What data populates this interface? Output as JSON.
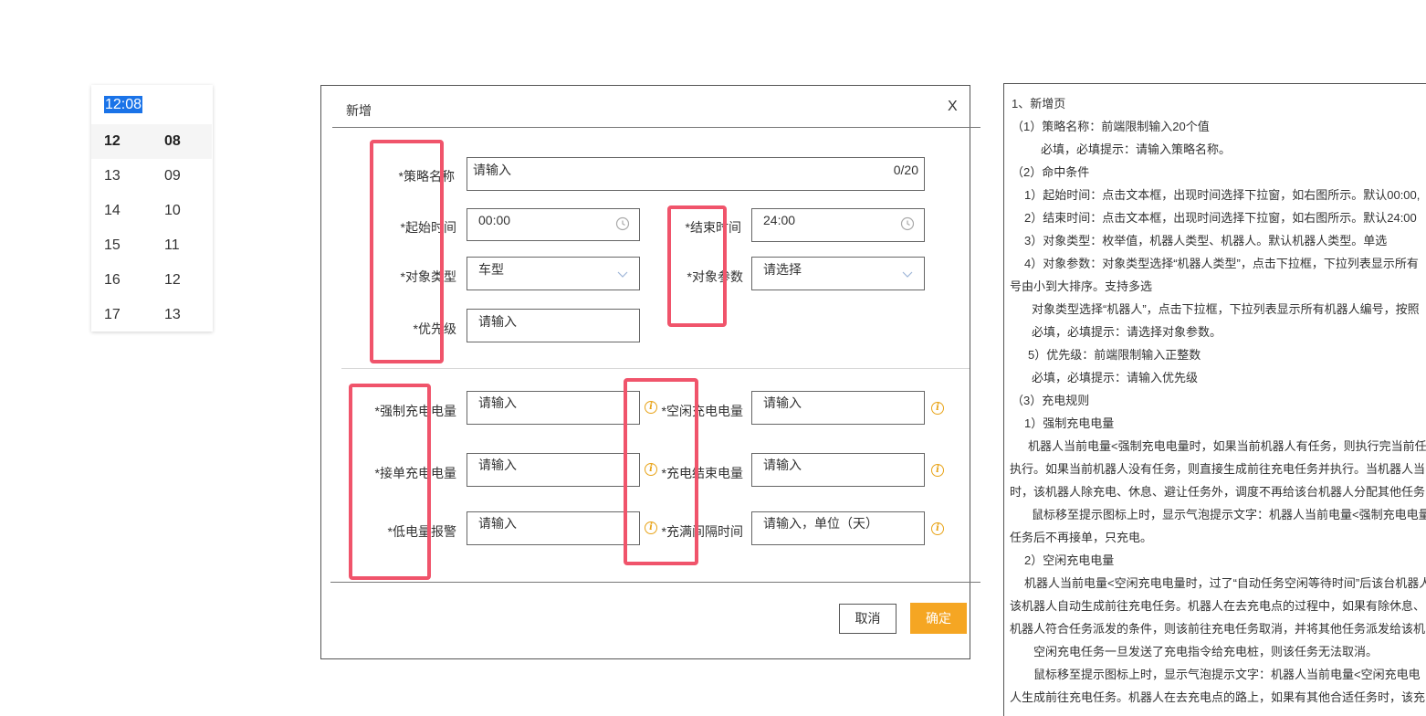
{
  "timepicker": {
    "value": "12:08",
    "hours": [
      "12",
      "13",
      "14",
      "15",
      "16",
      "17"
    ],
    "minutes": [
      "08",
      "09",
      "10",
      "11",
      "12",
      "13"
    ]
  },
  "dialog": {
    "title": "新增",
    "close": "X",
    "fields": {
      "name": {
        "label": "*策略名称",
        "placeholder": "请输入",
        "count": "0/20"
      },
      "start_time": {
        "label": "*起始时间",
        "value": "00:00"
      },
      "end_time": {
        "label": "*结束时间",
        "value": "24:00"
      },
      "object_type": {
        "label": "*对象类型",
        "value": "车型"
      },
      "object_param": {
        "label": "*对象参数",
        "placeholder": "请选择"
      },
      "priority": {
        "label": "*优先级",
        "placeholder": "请输入"
      },
      "force_charge": {
        "label": "*强制充电电量",
        "placeholder": "请输入"
      },
      "idle_charge": {
        "label": "*空闲充电电量",
        "placeholder": "请输入"
      },
      "accept_order": {
        "label": "*接单充电电量",
        "placeholder": "请输入"
      },
      "charge_end": {
        "label": "*充电结束电量",
        "placeholder": "请输入"
      },
      "low_alarm": {
        "label": "*低电量报警",
        "placeholder": "请输入"
      },
      "full_interval": {
        "label": "*充满间隔时间",
        "placeholder": "请输入，单位（天）"
      }
    },
    "buttons": {
      "cancel": "取消",
      "ok": "确定"
    }
  },
  "colors": {
    "accent": "#f5a623",
    "highlight": "#f0546b",
    "selection": "#1a73e8"
  },
  "notes": [
    "1、新增页",
    "（1）策略名称：前端限制输入20个值",
    "必填，必填提示：请输入策略名称。",
    "（2）命中条件",
    "1）起始时间：点击文本框，出现时间选择下拉窗，如右图所示。默认00:00,",
    "2）结束时间：点击文本框，出现时间选择下拉窗，如右图所示。默认24:00",
    "3）对象类型：枚举值，机器人类型、机器人。默认机器人类型。单选",
    "4）对象参数：对象类型选择“机器人类型”，点击下拉框，下拉列表显示所有",
    "号由小到大排序。支持多选",
    "对象类型选择“机器人”，点击下拉框，下拉列表显示所有机器人编号，按照",
    "必填，必填提示：请选择对象参数。",
    "5）优先级：前端限制输入正整数",
    "必填，必填提示：请输入优先级",
    "（3）充电规则",
    "1）强制充电电量",
    "机器人当前电量<强制充电电量时，如果当前机器人有任务，则执行完当前任",
    "执行。如果当前机器人没有任务，则直接生成前往充电任务并执行。当机器人当",
    "时，该机器人除充电、休息、避让任务外，调度不再给该台机器人分配其他任务",
    "鼠标移至提示图标上时，显示气泡提示文字：机器人当前电量<强制充电电量",
    "任务后不再接单，只充电。",
    "2）空闲充电电量",
    "机器人当前电量<空闲充电电量时，过了“自动任务空闲等待时间”后该台机器人",
    "该机器人自动生成前往充电任务。机器人在去充电点的过程中，如果有除休息、",
    "机器人符合任务派发的条件，则该前往充电任务取消，并将其他任务派发给该机",
    "空闲充电任务一旦发送了充电指令给充电桩，则该任务无法取消。",
    "鼠标移至提示图标上时，显示气泡提示文字：机器人当前电量<空闲充电电",
    "人生成前往充电任务。机器人在去充电点的路上，如果有其他合适任务时，该充"
  ]
}
